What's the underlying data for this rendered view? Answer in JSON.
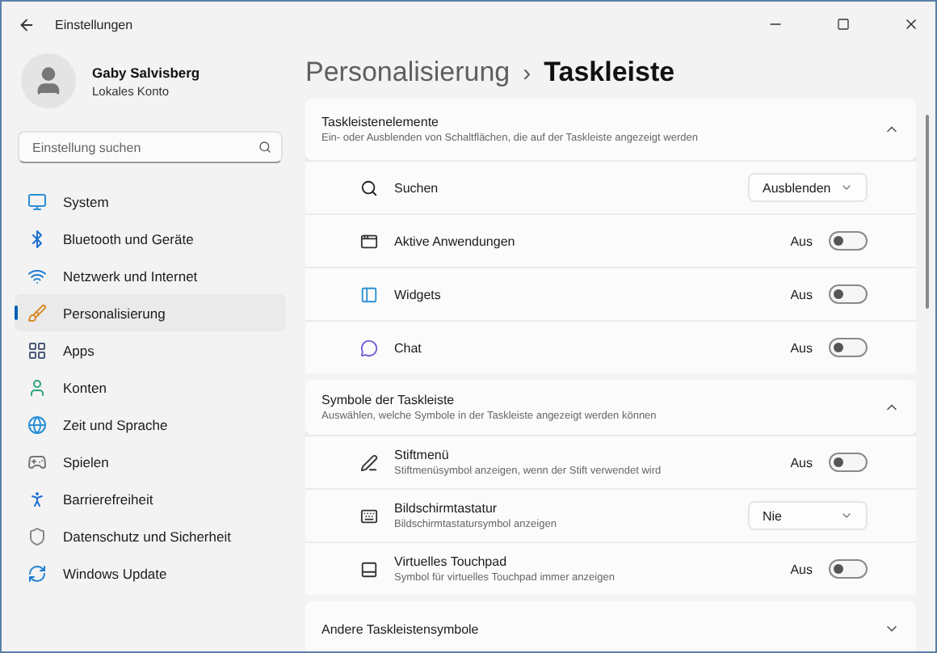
{
  "window": {
    "title": "Einstellungen"
  },
  "profile": {
    "name": "Gaby Salvisberg",
    "account": "Lokales Konto"
  },
  "search": {
    "placeholder": "Einstellung suchen"
  },
  "nav": [
    {
      "label": "System",
      "selected": false
    },
    {
      "label": "Bluetooth und Geräte",
      "selected": false
    },
    {
      "label": "Netzwerk und Internet",
      "selected": false
    },
    {
      "label": "Personalisierung",
      "selected": true
    },
    {
      "label": "Apps",
      "selected": false
    },
    {
      "label": "Konten",
      "selected": false
    },
    {
      "label": "Zeit und Sprache",
      "selected": false
    },
    {
      "label": "Spielen",
      "selected": false
    },
    {
      "label": "Barrierefreiheit",
      "selected": false
    },
    {
      "label": "Datenschutz und Sicherheit",
      "selected": false
    },
    {
      "label": "Windows Update",
      "selected": false
    }
  ],
  "breadcrumb": {
    "parent": "Personalisierung",
    "separator": "›",
    "current": "Taskleiste"
  },
  "sections": [
    {
      "title": "Taskleistenelemente",
      "subtitle": "Ein- oder Ausblenden von Schaltflächen, die auf der Taskleiste angezeigt werden",
      "expanded": true,
      "rows": [
        {
          "kind": "dropdown",
          "label": "Suchen",
          "value": "Ausblenden"
        },
        {
          "kind": "toggle",
          "label": "Aktive Anwendungen",
          "state_label": "Aus",
          "on": false
        },
        {
          "kind": "toggle",
          "label": "Widgets",
          "state_label": "Aus",
          "on": false
        },
        {
          "kind": "toggle",
          "label": "Chat",
          "state_label": "Aus",
          "on": false
        }
      ]
    },
    {
      "title": "Symbole der Taskleiste",
      "subtitle": "Auswählen, welche Symbole in der Taskleiste angezeigt werden können",
      "expanded": true,
      "rows": [
        {
          "kind": "toggle",
          "label": "Stiftmenü",
          "description": "Stiftmenüsymbol anzeigen, wenn der Stift verwendet wird",
          "state_label": "Aus",
          "on": false
        },
        {
          "kind": "dropdown",
          "label": "Bildschirmtastatur",
          "description": "Bildschirmtastatursymbol anzeigen",
          "value": "Nie"
        },
        {
          "kind": "toggle",
          "label": "Virtuelles Touchpad",
          "description": "Symbol für virtuelles Touchpad immer anzeigen",
          "state_label": "Aus",
          "on": false
        }
      ]
    },
    {
      "title": "Andere Taskleistensymbole",
      "expanded": false
    }
  ]
}
